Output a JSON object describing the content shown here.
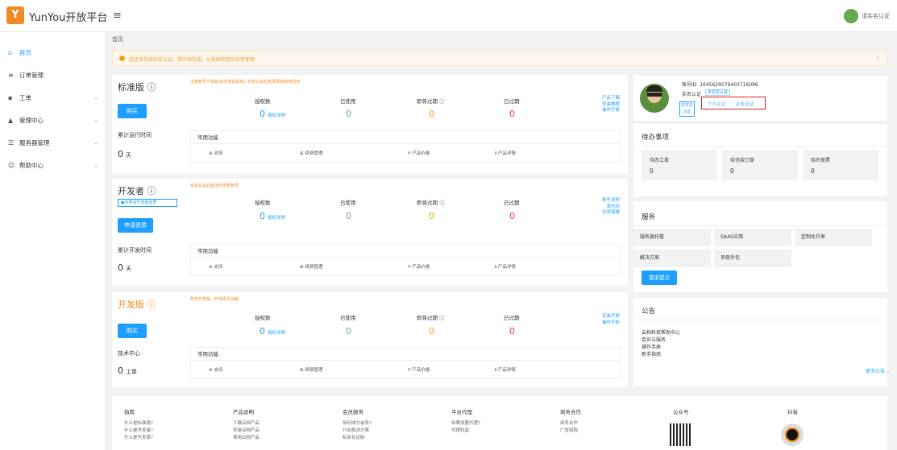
{
  "brand": {
    "logo_text": "Y",
    "name": "YunYou开放平台",
    "menu_icon": "≡"
  },
  "user": {
    "name": "请实名认证"
  },
  "sidebar": {
    "items": [
      {
        "icon": "home-icon",
        "label": "首页",
        "active": true
      },
      {
        "icon": "list-icon",
        "label": "订单管理"
      },
      {
        "icon": "ticket-icon",
        "label": "工单",
        "chevron": true
      },
      {
        "icon": "building-icon",
        "label": "管理中心",
        "chevron": true
      },
      {
        "icon": "server-icon",
        "label": "服务器管理",
        "chevron": true
      },
      {
        "icon": "help-icon",
        "label": "帮助中心",
        "chevron": true
      }
    ]
  },
  "breadcrumb": "首页",
  "notice": {
    "text": "您还未完成实名认证，请尽快完成，以免影响您的正常使用",
    "close": "×"
  },
  "metric_labels": {
    "auth": "授权数",
    "used": "已使用",
    "soon": "即将过期 ⓘ",
    "expired": "已过期",
    "detail": "授权详情"
  },
  "func": {
    "title": "常用功能",
    "support": "⊕ 支持",
    "renew": "⊞ 续费管理",
    "price": "¥ 产品价格",
    "info": "ℹ 产品详情"
  },
  "panels": [
    {
      "title": "标准版 ⓘ",
      "hint": "注册账号户获取30天测试授权，实名认证后免费获取商用授权",
      "button": "购买",
      "time_label": "累计运行时间",
      "value": "0",
      "unit": "天",
      "auth": "0",
      "used": "0",
      "soon": "0",
      "expired": "0",
      "links": [
        "产品下载",
        "安装教程",
        "操作手册"
      ]
    },
    {
      "title": "开发者 ⓘ",
      "hint": "实名认证后激活开发者账号",
      "tag": "●未申请开发者资质",
      "button": "申请资质",
      "time_label": "累计开发时间",
      "value": "0",
      "unit": "天",
      "auth": "0",
      "used": "0",
      "soon": "0",
      "expired": "0",
      "links": [
        "账号说明",
        "源代码",
        "环境搭建"
      ]
    },
    {
      "title": "开发版 ⓘ",
      "hint": "购买开发版，开通更多功能",
      "button": "购买",
      "time_label": "技术中心",
      "value": "0",
      "unit": "工单",
      "auth": "0",
      "used": "0",
      "soon": "0",
      "expired": "0",
      "links": [
        "安装手册",
        "操作手册"
      ]
    }
  ],
  "profile": {
    "account_label": "账号ID",
    "account_id": "1645629076403716096",
    "cert_label": "实名认证",
    "cert_status": "未实名认证",
    "go_cert": "去实名认证",
    "personal": "个人认证",
    "enterprise": "企业认证"
  },
  "todo": {
    "title": "待办事项",
    "items": [
      {
        "label": "待办工单",
        "value": "0"
      },
      {
        "label": "待付款订单",
        "value": "0"
      },
      {
        "label": "待开发票",
        "value": "0"
      }
    ]
  },
  "services": {
    "title": "服务",
    "items": [
      "服务器托管",
      "SAAS应用",
      "定制化开发",
      "解决方案",
      "项目外包"
    ],
    "button": "需求提交"
  },
  "announce": {
    "title": "公告",
    "items": [
      "云档科技帮助中心",
      "会员与服务",
      "操作手册",
      "新手指南"
    ],
    "more": "更多公告..."
  },
  "footer": [
    {
      "title": "指南",
      "links": [
        "什么是标准版?",
        "什么是开发者?",
        "什么是开发版?"
      ]
    },
    {
      "title": "产品说明",
      "links": [
        "下载云档产品",
        "安装云档产品",
        "使用云档产品"
      ]
    },
    {
      "title": "会员服务",
      "links": [
        "如何成为会员?",
        "行业解决方案",
        "私有化定制"
      ]
    },
    {
      "title": "平台代理",
      "links": [
        "如果加盟代理?",
        "代理权益"
      ]
    },
    {
      "title": "商务合作",
      "links": [
        "商务合作",
        "广告招租"
      ]
    },
    {
      "title": "公众号",
      "links": []
    },
    {
      "title": "抖音",
      "links": []
    }
  ]
}
